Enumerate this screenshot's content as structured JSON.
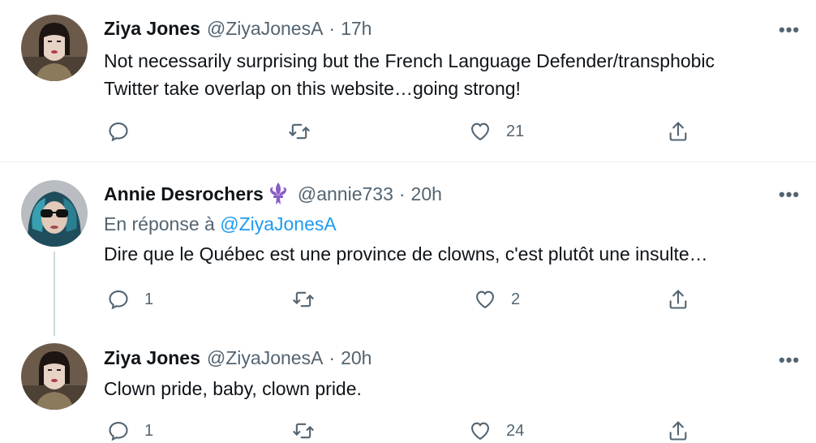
{
  "tweets": [
    {
      "name": "Ziya Jones",
      "handle": "@ZiyaJonesA",
      "time": "17h",
      "text_lines": [
        "Not necessarily surprising but the French Language Defender/transphobic",
        "Twitter take overlap on this website…going strong!"
      ],
      "replies": "",
      "retweets": "",
      "likes": "21"
    },
    {
      "name": "Annie Desrochers",
      "name_emoji": "fleur-de-lis-icon",
      "handle": "@annie733",
      "time": "20h",
      "reply_prefix": "En réponse à",
      "reply_handle": "@ZiyaJonesA",
      "text_lines": [
        "Dire que le Québec est une province de clowns, c'est plutôt une insulte…"
      ],
      "replies": "1",
      "retweets": "",
      "likes": "2"
    },
    {
      "name": "Ziya Jones",
      "handle": "@ZiyaJonesA",
      "time": "20h",
      "text_lines": [
        "Clown pride, baby, clown pride."
      ],
      "replies": "1",
      "retweets": "",
      "likes": "24"
    }
  ],
  "separator": "·",
  "more_glyph": "•••",
  "colors": {
    "text": "#0f1419",
    "secondary": "#536471",
    "link": "#1d9bf0",
    "divider": "#eff3f4",
    "fleur": "#8a5cc7"
  }
}
